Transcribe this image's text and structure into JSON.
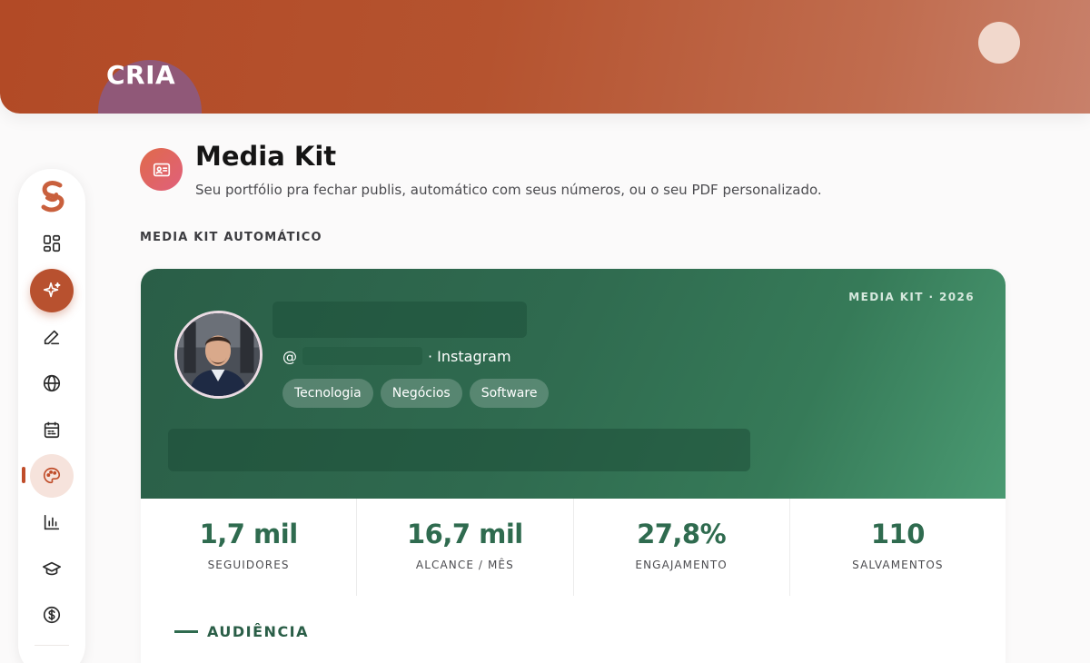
{
  "brand": {
    "name": "CRIA"
  },
  "sidebar": {
    "items": [
      {
        "icon": "dashboard-icon"
      },
      {
        "icon": "sparkles-icon"
      },
      {
        "icon": "pencil-icon"
      },
      {
        "icon": "globe-icon"
      },
      {
        "icon": "calendar-icon"
      },
      {
        "icon": "palette-icon"
      },
      {
        "icon": "bar-chart-icon"
      },
      {
        "icon": "graduation-cap-icon"
      },
      {
        "icon": "dollar-icon"
      }
    ]
  },
  "page": {
    "title": "Media Kit",
    "subtitle": "Seu portfólio pra fechar publis, automático com seus números, ou o seu PDF personalizado.",
    "section_label": "MEDIA KIT AUTOMÁTICO"
  },
  "kit": {
    "year_label": "MEDIA KIT · 2026",
    "handle_prefix": "@",
    "platform_suffix": "· Instagram",
    "tags": [
      "Tecnologia",
      "Negócios",
      "Software"
    ],
    "stats": [
      {
        "value": "1,7 mil",
        "label": "SEGUIDORES"
      },
      {
        "value": "16,7 mil",
        "label": "ALCANCE / MÊS"
      },
      {
        "value": "27,8%",
        "label": "ENGAJAMENTO"
      },
      {
        "value": "110",
        "label": "SALVAMENTOS"
      }
    ],
    "audience_label": "AUDIÊNCIA"
  },
  "colors": {
    "brand_orange": "#b8512f",
    "kit_green": "#2f6b4f"
  }
}
